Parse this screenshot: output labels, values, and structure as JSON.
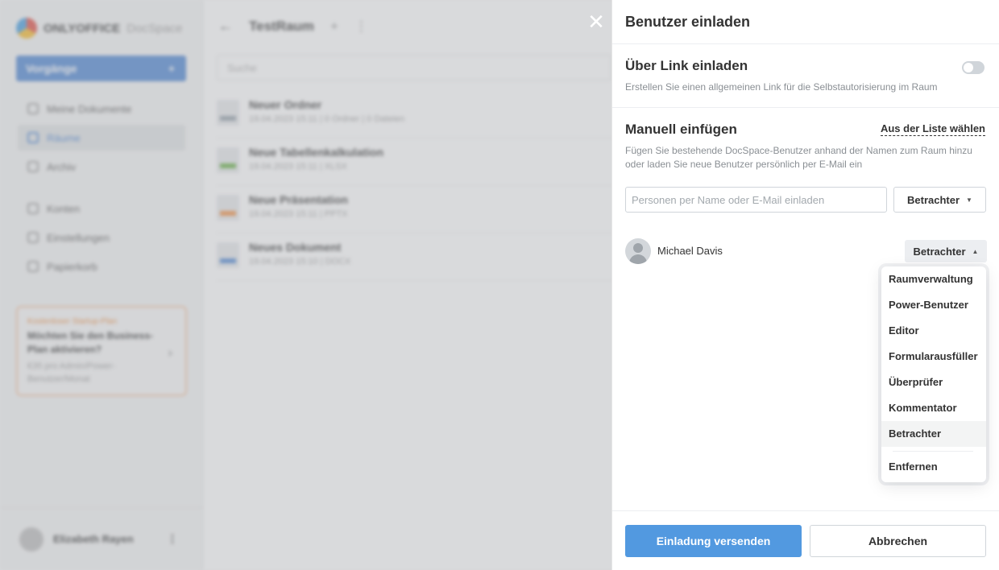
{
  "app": {
    "logo_text": "ONLYOFFICE",
    "logo_suffix": "DocSpace",
    "actions_label": "Vorgänge",
    "nav": [
      {
        "label": "Meine Dokumente"
      },
      {
        "label": "Räume"
      },
      {
        "label": "Archiv"
      },
      {
        "label": "Konten"
      },
      {
        "label": "Einstellungen"
      },
      {
        "label": "Papierkorb"
      }
    ],
    "promo": {
      "line1": "Kostenloser Startup-Plan",
      "line2": "Möchten Sie den Business-Plan aktivieren?",
      "line3": "€35 pro Admin/Power-Benutzer/Monat"
    },
    "user_name": "Elizabeth Rayen",
    "room_title": "TestRaum",
    "search_placeholder": "Suche",
    "files": [
      {
        "title": "Neuer Ordner",
        "meta": "19.04.2023 15:11 | 0 Ordner | 0 Dateien",
        "color": "#8e9aa5"
      },
      {
        "title": "Neue Tabellenkalkulation",
        "meta": "19.04.2023 15:11 | XLSX",
        "color": "#5fab3b"
      },
      {
        "title": "Neue Präsentation",
        "meta": "19.04.2023 15:11 | PPTX",
        "color": "#f08a3a"
      },
      {
        "title": "Neues Dokument",
        "meta": "19.04.2023 15:10 | DOCX",
        "color": "#4781d1"
      }
    ]
  },
  "panel": {
    "title": "Benutzer einladen",
    "link_section": {
      "title": "Über Link einladen",
      "description": "Erstellen Sie einen allgemeinen Link für die Selbstautorisierung im Raum",
      "toggle_on": false
    },
    "manual": {
      "title": "Manuell einfügen",
      "from_list": "Aus der Liste wählen",
      "description": "Fügen Sie bestehende DocSpace-Benutzer anhand der Namen zum Raum hinzu oder laden Sie neue Benutzer persönlich per E-Mail ein",
      "input_placeholder": "Personen per Name oder E-Mail einladen",
      "role": "Betrachter"
    },
    "invited_user": {
      "name": "Michael Davis",
      "role": "Betrachter"
    },
    "role_menu": {
      "items": [
        "Raumverwaltung",
        "Power-Benutzer",
        "Editor",
        "Formularausfüller",
        "Überprüfer",
        "Kommentator",
        "Betrachter"
      ],
      "selected": "Betrachter",
      "remove_label": "Entfernen"
    },
    "footer": {
      "send_label": "Einladung versenden",
      "cancel_label": "Abbrechen"
    }
  }
}
